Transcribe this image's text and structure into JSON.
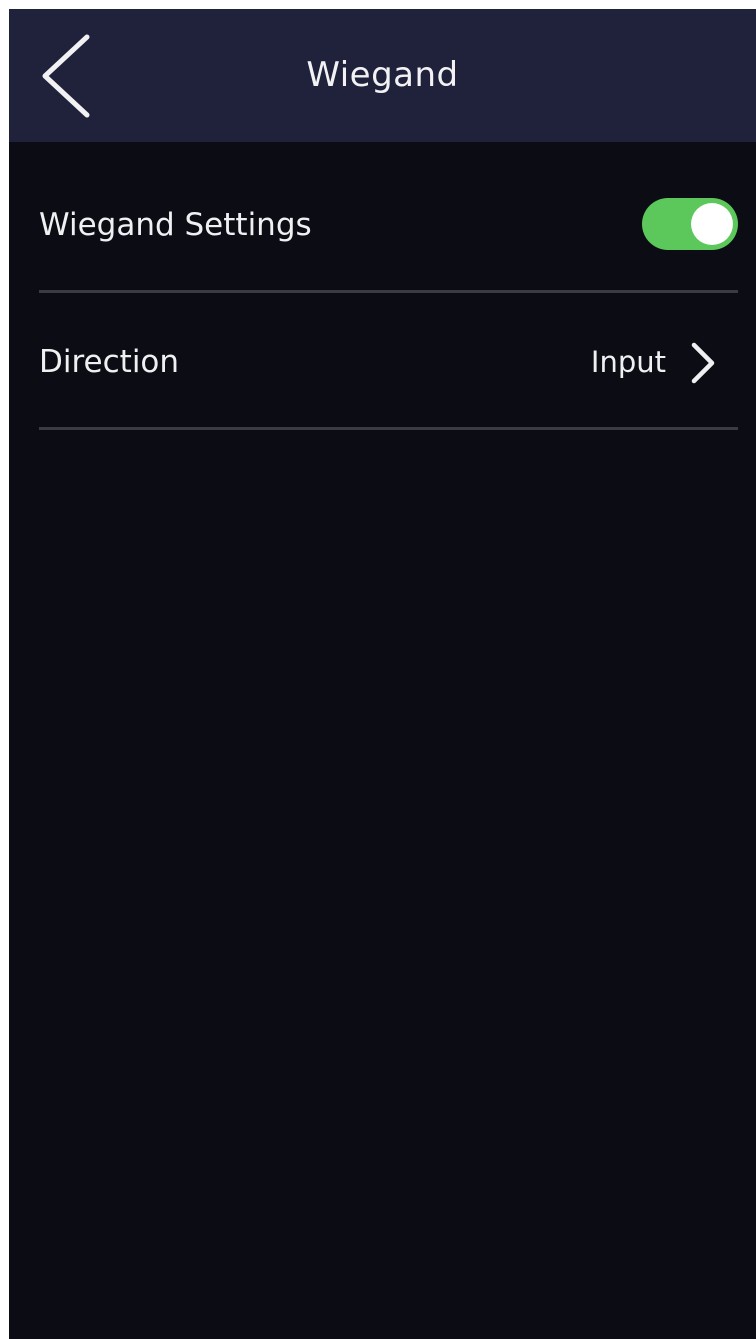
{
  "header": {
    "title": "Wiegand",
    "back_icon": "chevron-left-icon",
    "background_color": "#20213a"
  },
  "settings": {
    "wiegand_settings": {
      "label": "Wiegand Settings",
      "enabled": true,
      "toggle_color": "#5cc75a"
    },
    "direction": {
      "label": "Direction",
      "value": "Input",
      "icon": "chevron-right-icon"
    }
  },
  "colors": {
    "background": "#0b0c14",
    "text": "#f0f0f3",
    "divider": "#3a3b44"
  }
}
